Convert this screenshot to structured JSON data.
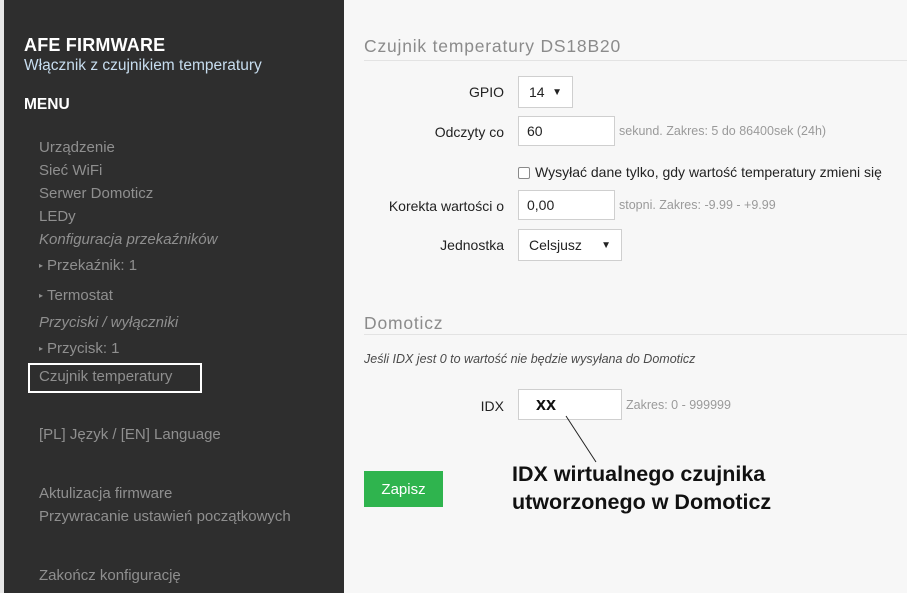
{
  "sidebar": {
    "brand_title": "AFE FIRMWARE",
    "brand_subtitle": "Włącznik z czujnikiem temperatury",
    "menu_title": "MENU",
    "items": [
      {
        "label": "Urządzenie"
      },
      {
        "label": "Sieć WiFi"
      },
      {
        "label": "Serwer Domoticz"
      },
      {
        "label": "LEDy"
      },
      {
        "label": "Konfiguracja przekaźników"
      },
      {
        "label": "Przekaźnik: 1"
      },
      {
        "label": "Termostat"
      },
      {
        "label": "Przyciski / wyłączniki"
      },
      {
        "label": "Przycisk: 1"
      },
      {
        "label": "Czujnik temperatury"
      },
      {
        "label": "[PL] Język / [EN] Language"
      },
      {
        "label": "Aktulizacja firmware"
      },
      {
        "label": "Przywracanie ustawień początkowych"
      },
      {
        "label": "Zakończ konfigurację"
      }
    ]
  },
  "sensor_section": {
    "title": "Czujnik temperatury DS18B20",
    "gpio": {
      "label": "GPIO",
      "value": "14"
    },
    "interval": {
      "label": "Odczyty co",
      "value": "60",
      "hint": "sekund. Zakres: 5 do 86400sek (24h)"
    },
    "only_on_change": {
      "label": "Wysyłać dane tylko, gdy wartość temperatury zmieni się",
      "checked": false
    },
    "correction": {
      "label": "Korekta wartości o",
      "value": "0,00",
      "hint": "stopni. Zakres: -9.99 - +9.99"
    },
    "unit": {
      "label": "Jednostka",
      "value": "Celsjusz"
    }
  },
  "domoticz_section": {
    "title": "Domoticz",
    "note": "Jeśli IDX jest 0 to wartość nie będzie wysyłana do Domoticz",
    "idx": {
      "label": "IDX",
      "value": "xx",
      "hint": "Zakres: 0 - 999999"
    }
  },
  "save_button": "Zapisz",
  "annotation": {
    "line1": "IDX wirtualnego czujnika",
    "line2": "utworzonego w Domoticz"
  },
  "colors": {
    "sidebar_bg": "#2e2e2e",
    "save_button": "#2fb44e"
  }
}
